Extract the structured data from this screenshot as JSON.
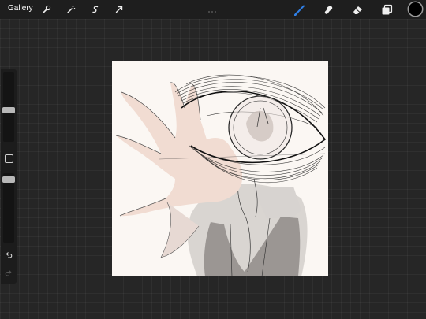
{
  "topbar": {
    "gallery_label": "Gallery",
    "tools_left": [
      "wrench-icon",
      "magic-wand-icon",
      "selection-icon",
      "transform-arrow-icon"
    ],
    "tools_right": [
      "brush-icon",
      "smudge-icon",
      "eraser-icon",
      "layers-icon"
    ],
    "active_tool": "brush-icon",
    "current_color": "#000000",
    "accent": "#2f7fe6"
  },
  "sidebar": {
    "brush_size_level": 0.45,
    "opacity_level": 0.18,
    "buttons": [
      "modify-button",
      "undo-icon",
      "redo-icon"
    ]
  }
}
